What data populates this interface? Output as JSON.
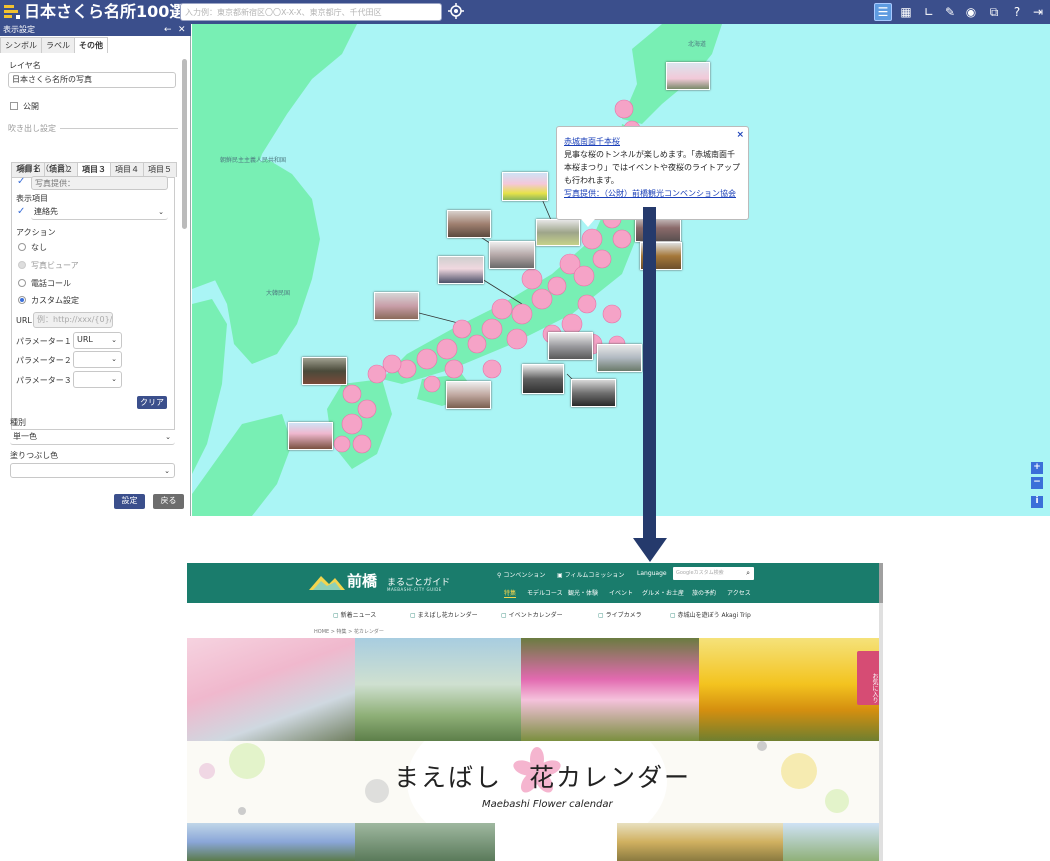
{
  "app": {
    "title": "日本さくら名所100選",
    "search_placeholder": "入力例：東京都新宿区〇〇X-X-X、東京都庁、千代田区"
  },
  "toolbar_icons": [
    "list-icon",
    "grid-icon",
    "measure-icon",
    "pen-icon",
    "compass-icon",
    "map-layers-icon",
    "help-icon",
    "logout-icon"
  ],
  "panel": {
    "title": "表示設定",
    "tabs": [
      "シンボル",
      "ラベル",
      "その他"
    ],
    "active_tab": "その他",
    "layer_name_label": "レイヤ名",
    "layer_name_value": "日本さくら名所の写真",
    "public_label": "公開",
    "balloon_label": "吹き出し設定",
    "item_tabs": [
      "項目１",
      "項目２",
      "項目３",
      "項目４",
      "項目５"
    ],
    "active_item_tab": "項目３",
    "item_name_label": "項目名（任意）",
    "item_name_value": "写真提供：",
    "display_item_label": "表示項目",
    "display_item_value": "連絡先",
    "action_label": "アクション",
    "actions": [
      "なし",
      "写真ビューア",
      "電話コール",
      "カスタム設定"
    ],
    "selected_action": "カスタム設定",
    "url_label": "URL",
    "url_placeholder": "例：http://xxx/{0}/…",
    "params": [
      {
        "label": "パラメーター１",
        "value": "URL"
      },
      {
        "label": "パラメーター２",
        "value": ""
      },
      {
        "label": "パラメーター３",
        "value": ""
      }
    ],
    "clear_button": "クリア",
    "type_label": "種別",
    "type_value": "単一色",
    "fill_label": "塗りつぶし色",
    "fill_value": "",
    "ok_button": "設定",
    "back_button": "戻る"
  },
  "map": {
    "labels": {
      "hokkaido": "北海道",
      "north_korea": "朝鮮民主主義人民共和国",
      "south_korea": "大韓民国"
    },
    "popup": {
      "title": "赤城南面千本桜",
      "body": "見事な桜のトンネルが楽しめます。「赤城南面千本桜まつり」ではイベントや夜桜のライトアップも行われます。",
      "credit": "写真提供：（公財）前橋観光コンベンション協会",
      "close": "×"
    },
    "zoom": [
      "+",
      "−",
      "i"
    ]
  },
  "website": {
    "site_name": "前橋",
    "site_sub": "まるごとガイド",
    "site_tag": "MAEBASHI-CITY GUIDE",
    "util_links": [
      "コンベンション",
      "フィルムコミッション",
      "Language"
    ],
    "search_placeholder": "Googleカスタム検索",
    "nav": [
      "特集",
      "モデルコース",
      "観光・体験",
      "イベント",
      "グルメ・お土産",
      "旅の予約",
      "アクセス"
    ],
    "selected_nav": "特集",
    "sub_nav": [
      "新着ニュース",
      "まえばし花カレンダー",
      "イベントカレンダー",
      "ライブカメラ",
      "赤城山を遊ぼう Akagi Trip"
    ],
    "breadcrumb": "HOME > 特集 > 花カレンダー",
    "favorite": "お気に入り",
    "main_title": "まえばし　花カレンダー",
    "main_subtitle": "Maebashi Flower calendar"
  },
  "colors": {
    "header": "#3b4f8c",
    "sea": "#aaf5f5",
    "land": "#78efb4",
    "sakura": "#f5a3c7",
    "site_header": "#1a7c6c"
  }
}
